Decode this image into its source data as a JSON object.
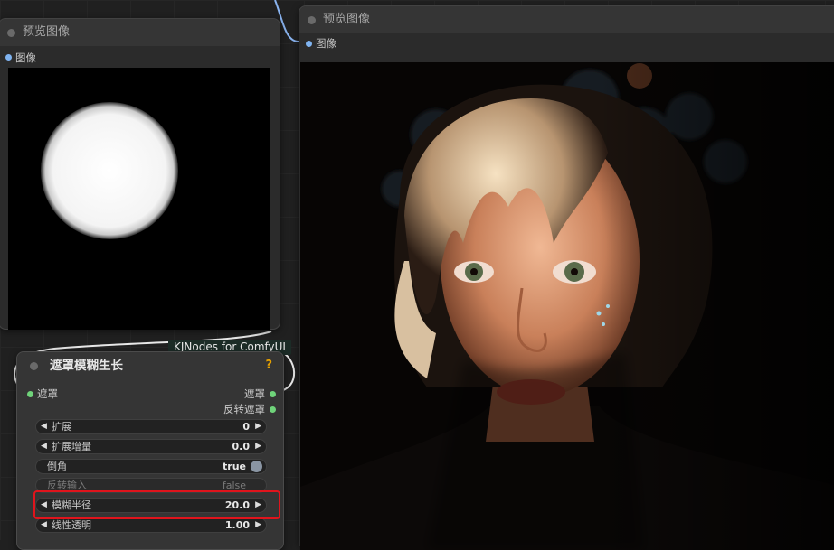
{
  "preview_left": {
    "title": "预览图像",
    "input_label": "图像"
  },
  "preview_right": {
    "title": "预览图像",
    "input_label": "图像"
  },
  "mask_blur_node": {
    "badge": "KJNodes for ComfyUI",
    "title": "遮罩模糊生长",
    "help": "?",
    "input_label": "遮罩",
    "outputs": [
      "遮罩",
      "反转遮罩"
    ],
    "widgets": [
      {
        "label": "扩展",
        "value": "0"
      },
      {
        "label": "扩展增量",
        "value": "0.0"
      },
      {
        "label": "倒角",
        "value": "true"
      },
      {
        "label": "反转输入",
        "value": "false"
      },
      {
        "label": "模糊半径",
        "value": "20.0"
      },
      {
        "label": "线性透明",
        "value": "1.00"
      }
    ]
  },
  "colors": {
    "image_slot": "#7fb3f0",
    "mask_slot": "#6fd37a",
    "highlight": "#e0141c",
    "badge_bg": "#1c2c27"
  }
}
